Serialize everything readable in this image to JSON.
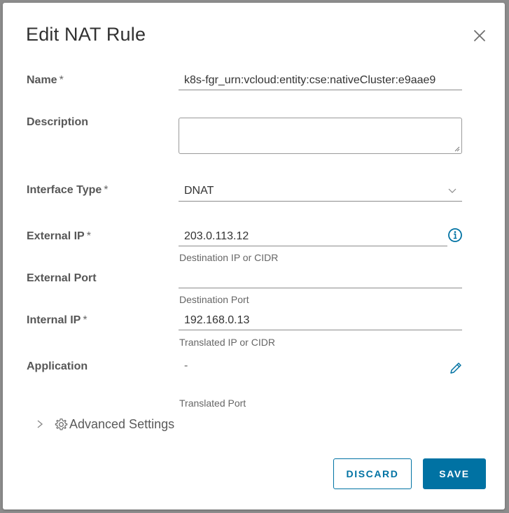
{
  "dialog": {
    "title": "Edit NAT Rule",
    "close_icon": "close-icon"
  },
  "required_marker": "*",
  "fields": {
    "name": {
      "label": "Name",
      "value": "k8s-fgr_urn:vcloud:entity:cse:nativeCluster:e9aae9"
    },
    "description": {
      "label": "Description",
      "value": ""
    },
    "interface_type": {
      "label": "Interface Type",
      "value": "DNAT",
      "icon": "chevron-down-icon"
    },
    "external_ip": {
      "label": "External IP",
      "value": "203.0.113.12",
      "helper": "Destination IP or CIDR",
      "icon": "info-icon"
    },
    "external_port": {
      "label": "External Port",
      "value": "",
      "helper": "Destination Port"
    },
    "internal_ip": {
      "label": "Internal IP",
      "value": "192.168.0.13",
      "helper": "Translated IP or CIDR"
    },
    "application": {
      "label": "Application",
      "value": "-",
      "icon": "pencil-icon"
    },
    "translated_port": {
      "helper": "Translated Port"
    }
  },
  "advanced": {
    "label": "Advanced Settings",
    "icons": [
      "chevron-right-icon",
      "gear-icon"
    ]
  },
  "buttons": {
    "discard": "DISCARD",
    "save": "SAVE"
  },
  "colors": {
    "accent": "#0072a3",
    "overlay": "#8c8c8c"
  }
}
